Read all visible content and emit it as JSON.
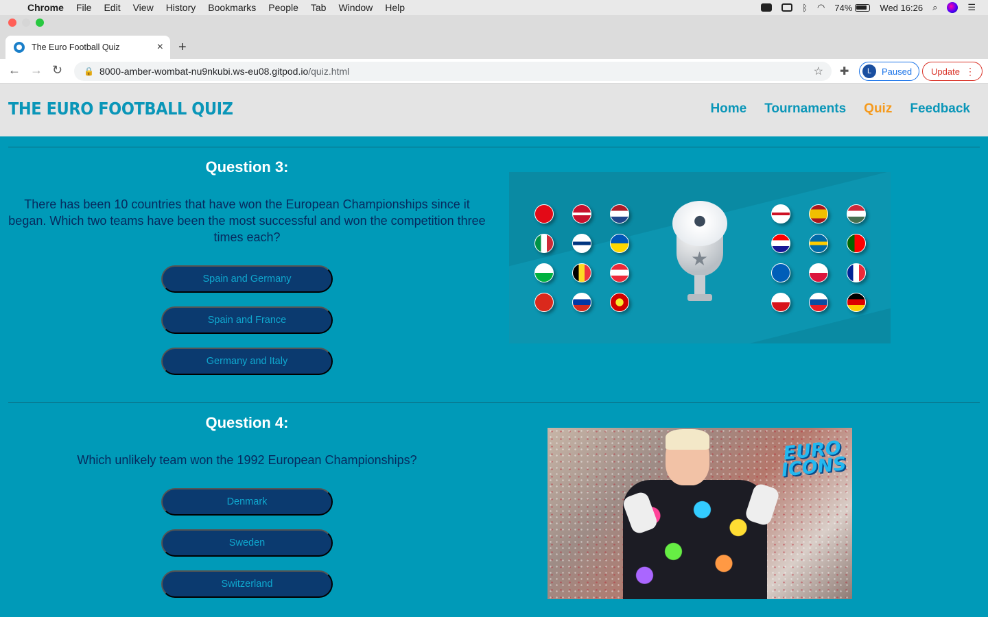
{
  "menubar": {
    "app": "Chrome",
    "items": [
      "File",
      "Edit",
      "View",
      "History",
      "Bookmarks",
      "People",
      "Tab",
      "Window",
      "Help"
    ],
    "battery": "74%",
    "clock": "Wed 16:26"
  },
  "tab": {
    "title": "The Euro Football Quiz",
    "close": "×",
    "new": "+"
  },
  "address": {
    "host": "8000-amber-wombat-nu9nkubi.ws-eu08.gitpod.io",
    "path": "/quiz.html"
  },
  "profile": {
    "initial": "L",
    "label": "Paused"
  },
  "update_label": "Update",
  "site": {
    "logo": "THE EURO FOOTBALL QUIZ",
    "nav": [
      "Home",
      "Tournaments",
      "Quiz",
      "Feedback"
    ],
    "active_nav": "Quiz"
  },
  "questions": [
    {
      "title": "Question 3:",
      "text": "There has been 10 countries that have won the European Championships since it began. Which two teams have been the most successful and won the competition three times each?",
      "answers": [
        "Spain and Germany",
        "Spain and France",
        "Germany and Italy"
      ]
    },
    {
      "title": "Question 4:",
      "text": "Which unlikely team won the 1992 European Championships?",
      "answers": [
        "Denmark",
        "Sweden",
        "Switzerland"
      ]
    }
  ],
  "images": {
    "q3": {
      "logo_text": ""
    },
    "q4": {
      "logo_text": "EURO ICONS"
    }
  },
  "colors": {
    "page_bg": "#009ab8",
    "header_bg": "#e4e4e4",
    "brand": "#0a96b8",
    "nav_active": "#f59a1d",
    "question_title": "#ffffff",
    "question_text": "#062a5e",
    "answer_bg": "#0b3a6f",
    "answer_text": "#0fa8cf"
  },
  "icons": {
    "menubar": [
      "apple-icon",
      "screen-record-icon",
      "airplay-icon",
      "bluetooth-icon",
      "wifi-icon",
      "battery-icon",
      "search-icon",
      "siri-icon",
      "control-center-icon"
    ],
    "toolbar": [
      "back-icon",
      "forward-icon",
      "reload-icon",
      "lock-icon",
      "bookmark-star-icon",
      "extensions-icon",
      "more-icon"
    ]
  }
}
